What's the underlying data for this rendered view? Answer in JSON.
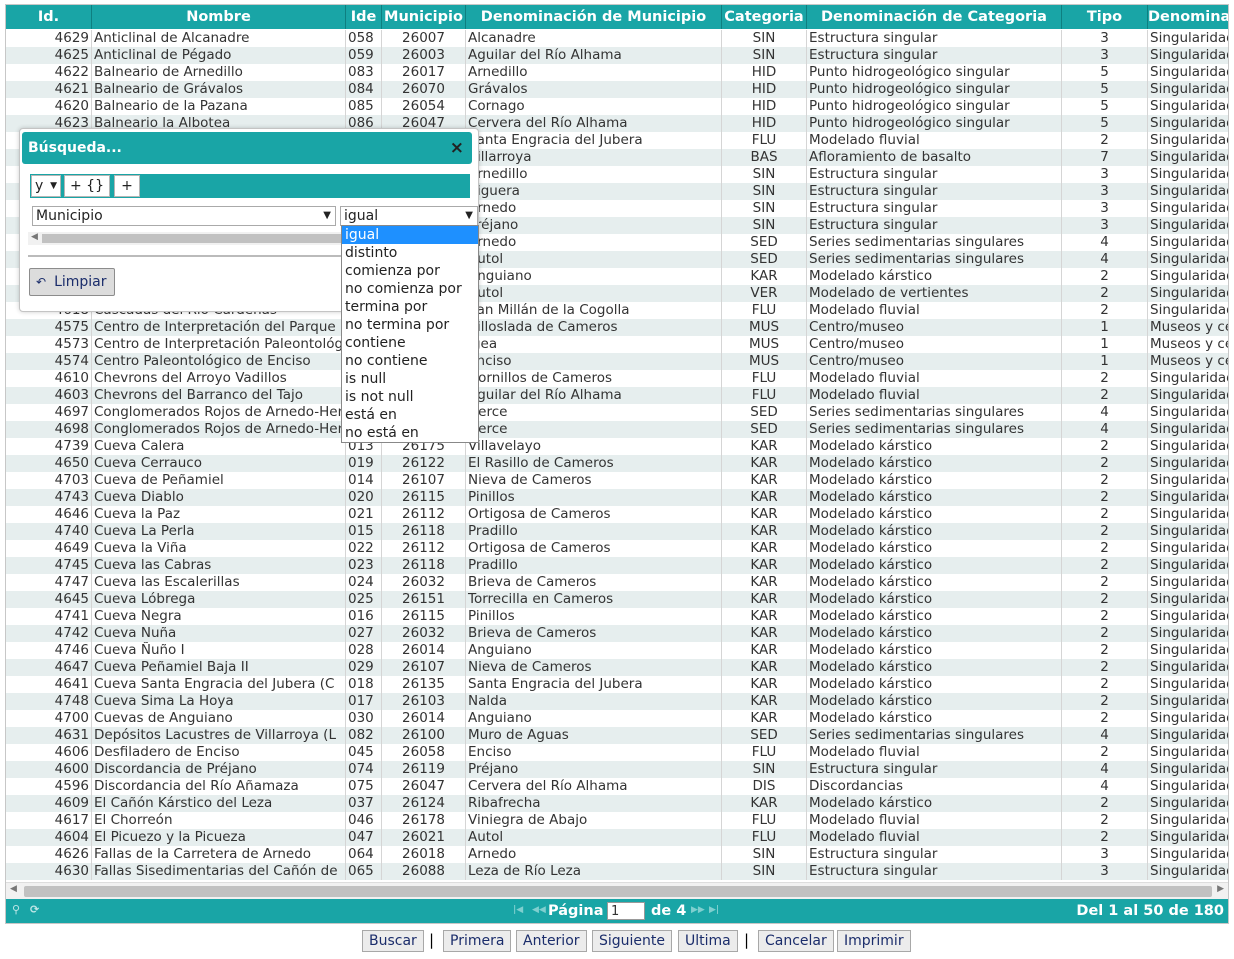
{
  "columns": [
    {
      "label": "Id.",
      "align": "r"
    },
    {
      "label": "Nombre",
      "align": "l"
    },
    {
      "label": "Ide",
      "align": "l"
    },
    {
      "label": "Municipio",
      "align": "ctr"
    },
    {
      "label": "Denominación de Municipio",
      "align": "l"
    },
    {
      "label": "Categoria",
      "align": "ctr"
    },
    {
      "label": "Denominación de Categoria",
      "align": "l"
    },
    {
      "label": "Tipo",
      "align": "ctr"
    },
    {
      "label": "Denominación de Tipo",
      "align": "l"
    }
  ],
  "rows": [
    [
      "4629",
      "Anticlinal de Alcanadre",
      "058",
      "26007",
      "Alcanadre",
      "SIN",
      "Estructura singular",
      "3",
      "Singularidad"
    ],
    [
      "4625",
      "Anticlinal de Pégado",
      "059",
      "26003",
      "Aguilar del Río Alhama",
      "SIN",
      "Estructura singular",
      "3",
      "Singularidad"
    ],
    [
      "4622",
      "Balneario de Arnedillo",
      "083",
      "26017",
      "Arnedillo",
      "HID",
      "Punto hidrogeológico singular",
      "5",
      "Singularidad"
    ],
    [
      "4621",
      "Balneario de Grávalos",
      "084",
      "26070",
      "Grávalos",
      "HID",
      "Punto hidrogeológico singular",
      "5",
      "Singularidad"
    ],
    [
      "4620",
      "Balneario de la Pazana",
      "085",
      "26054",
      "Cornago",
      "HID",
      "Punto hidrogeológico singular",
      "5",
      "Singularidad"
    ],
    [
      "4623",
      "Balneario la Albotea",
      "086",
      "26047",
      "Cervera del Río Alhama",
      "HID",
      "Punto hidrogeológico singular",
      "5",
      "Singularidad"
    ],
    [
      "",
      "",
      "",
      "",
      "Santa Engracia del Jubera",
      "FLU",
      "Modelado fluvial",
      "2",
      "Singularidad"
    ],
    [
      "",
      "",
      "",
      "",
      "Villarroya",
      "BAS",
      "Afloramiento de basalto",
      "7",
      "Singularidad"
    ],
    [
      "",
      "",
      "",
      "",
      "Arnedillo",
      "SIN",
      "Estructura singular",
      "3",
      "Singularidad"
    ],
    [
      "",
      "",
      "",
      "",
      "Viguera",
      "SIN",
      "Estructura singular",
      "3",
      "Singularidad"
    ],
    [
      "",
      "",
      "",
      "",
      "Arnedo",
      "SIN",
      "Estructura singular",
      "3",
      "Singularidad"
    ],
    [
      "",
      "",
      "",
      "",
      "Préjano",
      "SIN",
      "Estructura singular",
      "3",
      "Singularidad"
    ],
    [
      "",
      "",
      "",
      "",
      "Arnedo",
      "SED",
      "Series sedimentarias singulares",
      "4",
      "Singularidad"
    ],
    [
      "",
      "",
      "",
      "",
      "Autol",
      "SED",
      "Series sedimentarias singulares",
      "4",
      "Singularidad"
    ],
    [
      "",
      "",
      "",
      "",
      "Anguiano",
      "KAR",
      "Modelado kárstico",
      "2",
      "Singularidad"
    ],
    [
      "",
      "",
      "",
      "",
      "Autol",
      "VER",
      "Modelado de vertientes",
      "2",
      "Singularidad"
    ],
    [
      "4618",
      "Cascadas del Río Cárdenas",
      "",
      "",
      "San Millán de la Cogolla",
      "FLU",
      "Modelado fluvial",
      "2",
      "Singularidad"
    ],
    [
      "4575",
      "Centro de Interpretación del Parque",
      "",
      "",
      "Villoslada de Cameros",
      "MUS",
      "Centro/museo",
      "1",
      "Museos y centros"
    ],
    [
      "4573",
      "Centro de Interpretación Paleontológico",
      "",
      "",
      "Igea",
      "MUS",
      "Centro/museo",
      "1",
      "Museos y centros"
    ],
    [
      "4574",
      "Centro Paleontológico de Enciso",
      "",
      "",
      "Enciso",
      "MUS",
      "Centro/museo",
      "1",
      "Museos y centros"
    ],
    [
      "4610",
      "Chevrons del Arroyo Vadillos",
      "",
      "",
      "Hornillos de Cameros",
      "FLU",
      "Modelado fluvial",
      "2",
      "Singularidad"
    ],
    [
      "4603",
      "Chevrons del Barranco del Tajo",
      "",
      "",
      "Aguilar del Río Alhama",
      "FLU",
      "Modelado fluvial",
      "2",
      "Singularidad"
    ],
    [
      "4697",
      "Conglomerados Rojos de Arnedo-Herce",
      "",
      "",
      "Herce",
      "SED",
      "Series sedimentarias singulares",
      "4",
      "Singularidad"
    ],
    [
      "4698",
      "Conglomerados Rojos de Arnedo-Herce",
      "",
      "",
      "Herce",
      "SED",
      "Series sedimentarias singulares",
      "4",
      "Singularidad"
    ],
    [
      "4739",
      "Cueva Calera",
      "013",
      "26175",
      "Villavelayo",
      "KAR",
      "Modelado kárstico",
      "2",
      "Singularidad"
    ],
    [
      "4650",
      "Cueva Cerrauco",
      "019",
      "26122",
      "El Rasillo de Cameros",
      "KAR",
      "Modelado kárstico",
      "2",
      "Singularidad"
    ],
    [
      "4703",
      "Cueva de Peñamiel",
      "014",
      "26107",
      "Nieva de Cameros",
      "KAR",
      "Modelado kárstico",
      "2",
      "Singularidad"
    ],
    [
      "4743",
      "Cueva Diablo",
      "020",
      "26115",
      "Pinillos",
      "KAR",
      "Modelado kárstico",
      "2",
      "Singularidad"
    ],
    [
      "4646",
      "Cueva la Paz",
      "021",
      "26112",
      "Ortigosa de Cameros",
      "KAR",
      "Modelado kárstico",
      "2",
      "Singularidad"
    ],
    [
      "4740",
      "Cueva La Perla",
      "015",
      "26118",
      "Pradillo",
      "KAR",
      "Modelado kárstico",
      "2",
      "Singularidad"
    ],
    [
      "4649",
      "Cueva la Viña",
      "022",
      "26112",
      "Ortigosa de Cameros",
      "KAR",
      "Modelado kárstico",
      "2",
      "Singularidad"
    ],
    [
      "4745",
      "Cueva las Cabras",
      "023",
      "26118",
      "Pradillo",
      "KAR",
      "Modelado kárstico",
      "2",
      "Singularidad"
    ],
    [
      "4747",
      "Cueva las Escalerillas",
      "024",
      "26032",
      "Brieva de Cameros",
      "KAR",
      "Modelado kárstico",
      "2",
      "Singularidad"
    ],
    [
      "4645",
      "Cueva Lóbrega",
      "025",
      "26151",
      "Torrecilla en Cameros",
      "KAR",
      "Modelado kárstico",
      "2",
      "Singularidad"
    ],
    [
      "4741",
      "Cueva Negra",
      "016",
      "26115",
      "Pinillos",
      "KAR",
      "Modelado kárstico",
      "2",
      "Singularidad"
    ],
    [
      "4742",
      "Cueva Nuña",
      "027",
      "26032",
      "Brieva de Cameros",
      "KAR",
      "Modelado kárstico",
      "2",
      "Singularidad"
    ],
    [
      "4746",
      "Cueva Ñuño I",
      "028",
      "26014",
      "Anguiano",
      "KAR",
      "Modelado kárstico",
      "2",
      "Singularidad"
    ],
    [
      "4647",
      "Cueva Peñamiel Baja II",
      "029",
      "26107",
      "Nieva de Cameros",
      "KAR",
      "Modelado kárstico",
      "2",
      "Singularidad"
    ],
    [
      "4641",
      "Cueva Santa Engracia del Jubera (C",
      "018",
      "26135",
      "Santa Engracia del Jubera",
      "KAR",
      "Modelado kárstico",
      "2",
      "Singularidad"
    ],
    [
      "4748",
      "Cueva Sima La Hoya",
      "017",
      "26103",
      "Nalda",
      "KAR",
      "Modelado kárstico",
      "2",
      "Singularidad"
    ],
    [
      "4700",
      "Cuevas de Anguiano",
      "030",
      "26014",
      "Anguiano",
      "KAR",
      "Modelado kárstico",
      "2",
      "Singularidad"
    ],
    [
      "4631",
      "Depósitos Lacustres de Villarroya (L",
      "082",
      "26100",
      "Muro de Aguas",
      "SED",
      "Series sedimentarias singulares",
      "4",
      "Singularidad"
    ],
    [
      "4606",
      "Desfiladero de Enciso",
      "045",
      "26058",
      "Enciso",
      "FLU",
      "Modelado fluvial",
      "2",
      "Singularidad"
    ],
    [
      "4600",
      "Discordancia de Préjano",
      "074",
      "26119",
      "Préjano",
      "SIN",
      "Estructura singular",
      "4",
      "Singularidad"
    ],
    [
      "4596",
      "Discordancia del Río Añamaza",
      "075",
      "26047",
      "Cervera del Río Alhama",
      "DIS",
      "Discordancias",
      "4",
      "Singularidad"
    ],
    [
      "4609",
      "El Cañón Kárstico del Leza",
      "037",
      "26124",
      "Ribafrecha",
      "KAR",
      "Modelado kárstico",
      "2",
      "Singularidad"
    ],
    [
      "4617",
      "El Chorreón",
      "046",
      "26178",
      "Viniegra de Abajo",
      "FLU",
      "Modelado fluvial",
      "2",
      "Singularidad"
    ],
    [
      "4604",
      "El Picuezo y la Picueza",
      "047",
      "26021",
      "Autol",
      "FLU",
      "Modelado fluvial",
      "2",
      "Singularidad"
    ],
    [
      "4626",
      "Fallas de la Carretera de Arnedo",
      "064",
      "26018",
      "Arnedo",
      "SIN",
      "Estructura singular",
      "3",
      "Singularidad"
    ],
    [
      "4630",
      "Fallas Sisedimentarias del Cañón de",
      "065",
      "26088",
      "Leza de Río Leza",
      "SIN",
      "Estructura singular",
      "3",
      "Singularidad"
    ]
  ],
  "pager": {
    "page_label": "Página",
    "page_value": "1",
    "of_label": "de 4",
    "info": "Del 1 al 50 de 180"
  },
  "buttons": {
    "buscar": "Buscar",
    "primera": "Primera",
    "anterior": "Anterior",
    "siguiente": "Siguiente",
    "ultima": "Ultima",
    "cancelar": "Cancelar",
    "imprimir": "Imprimir",
    "sep": "|"
  },
  "dialog": {
    "title": "Búsqueda...",
    "close": "×",
    "group_op": "y",
    "add_group": "+ {}",
    "add_rule": "+",
    "field": "Municipio",
    "operator": "igual",
    "clear": "Limpiar",
    "operators": [
      "igual",
      "distinto",
      "comienza por",
      "no comienza por",
      "termina por",
      "no termina por",
      "contiene",
      "no contiene",
      "is null",
      "is not null",
      "está en",
      "no está en"
    ]
  },
  "colors": {
    "accent": "#19a5a6",
    "selected_option": "#1e90ff",
    "stripe": "#e6eeee"
  }
}
